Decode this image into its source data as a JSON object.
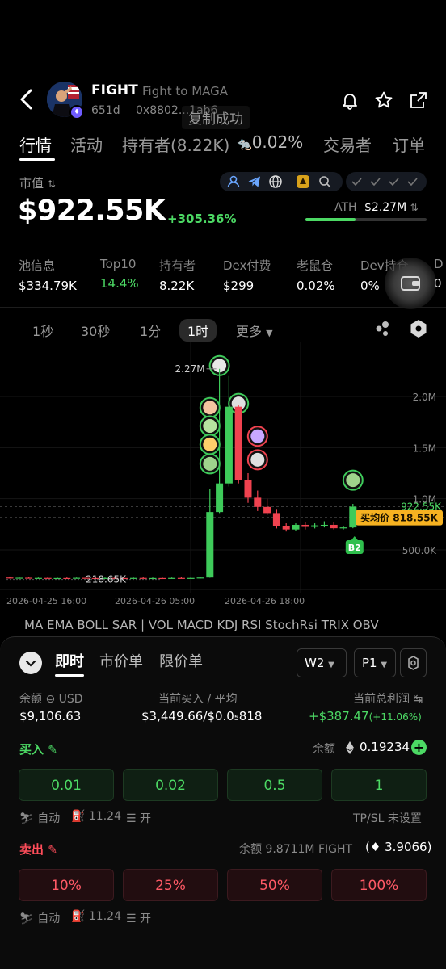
{
  "header": {
    "symbol": "FIGHT",
    "name": "Fight to MAGA",
    "age": "651d",
    "address": "0x8802...1ab6",
    "toast": "复制成功"
  },
  "tabs": [
    {
      "label": "行情",
      "active": true
    },
    {
      "label": "活动"
    },
    {
      "label": "持有者(8.22K)"
    },
    {
      "label": "0.02%"
    },
    {
      "label": "交易者"
    },
    {
      "label": "订单"
    }
  ],
  "market": {
    "label": "市值",
    "value": "$922.55K",
    "change": "+305.36%",
    "ath_label": "ATH",
    "ath_value": "$2.27M",
    "ath_fraction": 0.41
  },
  "stats": [
    {
      "label": "池信息",
      "value": "$334.79K"
    },
    {
      "label": "Top10",
      "value": "14.4%",
      "green": true
    },
    {
      "label": "持有者",
      "value": "8.22K"
    },
    {
      "label": "Dex付费",
      "value": "$299"
    },
    {
      "label": "老鼠仓",
      "value": "0.02%"
    },
    {
      "label": "Dev持仓",
      "value": "0%"
    },
    {
      "label": "D",
      "value": "0"
    }
  ],
  "intervals": [
    "1秒",
    "30秒",
    "1分",
    "1时",
    "更多"
  ],
  "active_interval": "1时",
  "chart_data": {
    "type": "candlestick",
    "y_ticks": [
      "2.0M",
      "1.5M",
      "1.0M",
      "500.0K"
    ],
    "x_ticks": [
      "2026-04-25 16:00",
      "2026-04-26 05:00",
      "2026-04-26 18:00"
    ],
    "high_label": "2.27M",
    "low_label": "218.65K",
    "current_label": "922.55K",
    "avg_buy_label": "买均价 818.55K",
    "marker_label": "B2",
    "ylim": [
      0,
      2400000
    ],
    "candles": [
      {
        "o": 230000,
        "h": 240000,
        "l": 220000,
        "c": 225000
      },
      {
        "o": 225000,
        "h": 232000,
        "l": 218650,
        "c": 228000
      },
      {
        "o": 228000,
        "h": 235000,
        "l": 222000,
        "c": 224000
      },
      {
        "o": 224000,
        "h": 230000,
        "l": 220000,
        "c": 226000
      },
      {
        "o": 226000,
        "h": 233000,
        "l": 221000,
        "c": 223000
      },
      {
        "o": 223000,
        "h": 229000,
        "l": 219000,
        "c": 225000
      },
      {
        "o": 225000,
        "h": 231000,
        "l": 220000,
        "c": 224000
      },
      {
        "o": 224000,
        "h": 230000,
        "l": 219500,
        "c": 227000
      },
      {
        "o": 227000,
        "h": 234000,
        "l": 221000,
        "c": 225000
      },
      {
        "o": 225000,
        "h": 232000,
        "l": 220000,
        "c": 224000
      },
      {
        "o": 224000,
        "h": 230000,
        "l": 220000,
        "c": 226000
      },
      {
        "o": 226000,
        "h": 231000,
        "l": 221000,
        "c": 225000
      },
      {
        "o": 225000,
        "h": 230000,
        "l": 220000,
        "c": 224000
      },
      {
        "o": 224000,
        "h": 229000,
        "l": 219000,
        "c": 226000
      },
      {
        "o": 226000,
        "h": 232000,
        "l": 221000,
        "c": 224000
      },
      {
        "o": 224000,
        "h": 230000,
        "l": 220000,
        "c": 225000
      },
      {
        "o": 225000,
        "h": 231000,
        "l": 220000,
        "c": 224000
      },
      {
        "o": 224000,
        "h": 230000,
        "l": 219000,
        "c": 226000
      },
      {
        "o": 226000,
        "h": 232000,
        "l": 221000,
        "c": 225000
      },
      {
        "o": 225000,
        "h": 230000,
        "l": 220000,
        "c": 226000
      },
      {
        "o": 226000,
        "h": 231000,
        "l": 221000,
        "c": 230000
      },
      {
        "o": 230000,
        "h": 1100000,
        "l": 228000,
        "c": 870000
      },
      {
        "o": 870000,
        "h": 2270000,
        "l": 860000,
        "c": 1150000
      },
      {
        "o": 1150000,
        "h": 2200000,
        "l": 1120000,
        "c": 1900000
      },
      {
        "o": 1900000,
        "h": 1920000,
        "l": 1150000,
        "c": 1180000
      },
      {
        "o": 1180000,
        "h": 1250000,
        "l": 960000,
        "c": 1010000
      },
      {
        "o": 1010000,
        "h": 1080000,
        "l": 880000,
        "c": 920000
      },
      {
        "o": 920000,
        "h": 1000000,
        "l": 840000,
        "c": 860000
      },
      {
        "o": 860000,
        "h": 900000,
        "l": 710000,
        "c": 730000
      },
      {
        "o": 730000,
        "h": 760000,
        "l": 680000,
        "c": 700000
      },
      {
        "o": 700000,
        "h": 760000,
        "l": 690000,
        "c": 745000
      },
      {
        "o": 745000,
        "h": 770000,
        "l": 700000,
        "c": 725000
      },
      {
        "o": 725000,
        "h": 760000,
        "l": 710000,
        "c": 740000
      },
      {
        "o": 740000,
        "h": 780000,
        "l": 720000,
        "c": 745000
      },
      {
        "o": 745000,
        "h": 770000,
        "l": 700000,
        "c": 712000
      },
      {
        "o": 712000,
        "h": 735000,
        "l": 700000,
        "c": 720000
      },
      {
        "o": 720000,
        "h": 950000,
        "l": 712000,
        "c": 922550
      }
    ],
    "markers": [
      {
        "candle": 22,
        "price": 2270000
      },
      {
        "candle": 21,
        "price": 1860000
      },
      {
        "candle": 21,
        "price": 1680000
      },
      {
        "candle": 21,
        "price": 1500000
      },
      {
        "candle": 21,
        "price": 1310000
      },
      {
        "candle": 24,
        "price": 1900000
      },
      {
        "candle": 26,
        "price": 1580000
      },
      {
        "candle": 26,
        "price": 1350000
      },
      {
        "candle": 36,
        "price": 1150000
      }
    ]
  },
  "indicators": "MA  EMA  BOLL  SAR  |  VOL  MACD  KDJ  RSI  StochRsi  TRIX  OBV",
  "trade": {
    "tabs": [
      "即时",
      "市价单",
      "限价单"
    ],
    "wallet_select": "W2",
    "preset_select": "P1",
    "balance_label": "余额",
    "balance_unit": "USD",
    "balance_value": "$9,106.63",
    "buy_avg_label": "当前买入 / 平均",
    "buy_avg_value": "$3,449.66/$0.0₅818",
    "pnl_label": "当前总利润",
    "pnl_value": "+$387.47",
    "pnl_pct": "(+11.06%)",
    "buy_label": "买入",
    "buy_balance_label": "余额",
    "buy_balance_value": "0.19234",
    "buy_amounts": [
      "0.01",
      "0.02",
      "0.5",
      "1"
    ],
    "auto_label": "自动",
    "gas_value": "11.24",
    "mev_label": "开",
    "tpsl_label": "TP/SL 未设置",
    "sell_label": "卖出",
    "sell_balance_text": "余额 9.8711M FIGHT",
    "sell_balance_eth": "3.9066",
    "sell_amounts": [
      "10%",
      "25%",
      "50%",
      "100%"
    ],
    "auto_label2": "自动",
    "gas_value2": "11.24",
    "mev_label2": "开"
  }
}
